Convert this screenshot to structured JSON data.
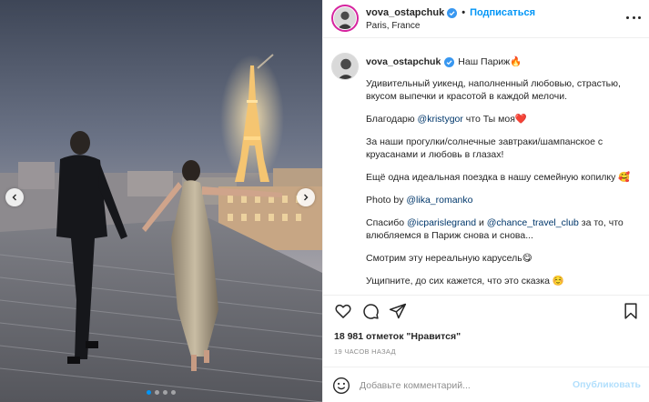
{
  "post": {
    "username": "vova_ostapchuk",
    "follow_label": "Подписаться",
    "dot_separator": "•",
    "location": "Paris, France",
    "caption": {
      "username": "vova_ostapchuk",
      "headline": "Наш Париж🔥",
      "paragraph_1": "Удивительный уикенд, наполненный любовью, страстью, вкусом выпечки и красотой в каждой мелочи.",
      "thanks_prefix": "Благодарю ",
      "thanks_mention": "@kristygor",
      "thanks_suffix": " что Ты моя❤️",
      "paragraph_3": "За наши прогулки/солнечные завтраки/шампанское с круасанами и любовь в глазах!",
      "paragraph_4": "Ещё одна идеальная поездка в нашу семейную копилку 🥰",
      "photo_prefix": "Photo by ",
      "photo_mention": "@lika_romanko",
      "thanks2_prefix": "Спасибо ",
      "thanks2_mention_1": "@icparislegrand",
      "thanks2_and": " и ",
      "thanks2_mention_2": "@chance_travel_club",
      "thanks2_suffix": " за то, что влюбляемся в Париж снова и снова...",
      "paragraph_7": "Смотрим эту нереальную карусель😋",
      "paragraph_8": "Ущипните, до сих кажется, что это сказка ☺️"
    },
    "likes": "18 981 отметок \"Нравится\"",
    "timestamp": "19 ЧАСОВ НАЗАД",
    "comment_placeholder": "Добавьте комментарий...",
    "publish_label": "Опубликовать",
    "carousel": {
      "total_slides": 4,
      "active_slide": 1
    },
    "colors": {
      "accent": "#0095f6",
      "verified": "#3897f0",
      "publish_disabled": "#b2dffc"
    },
    "icons": [
      "chevron-left-icon",
      "chevron-right-icon",
      "more-options-icon",
      "verified-icon",
      "heart-icon",
      "comment-icon",
      "share-icon",
      "bookmark-icon",
      "emoji-icon"
    ]
  }
}
